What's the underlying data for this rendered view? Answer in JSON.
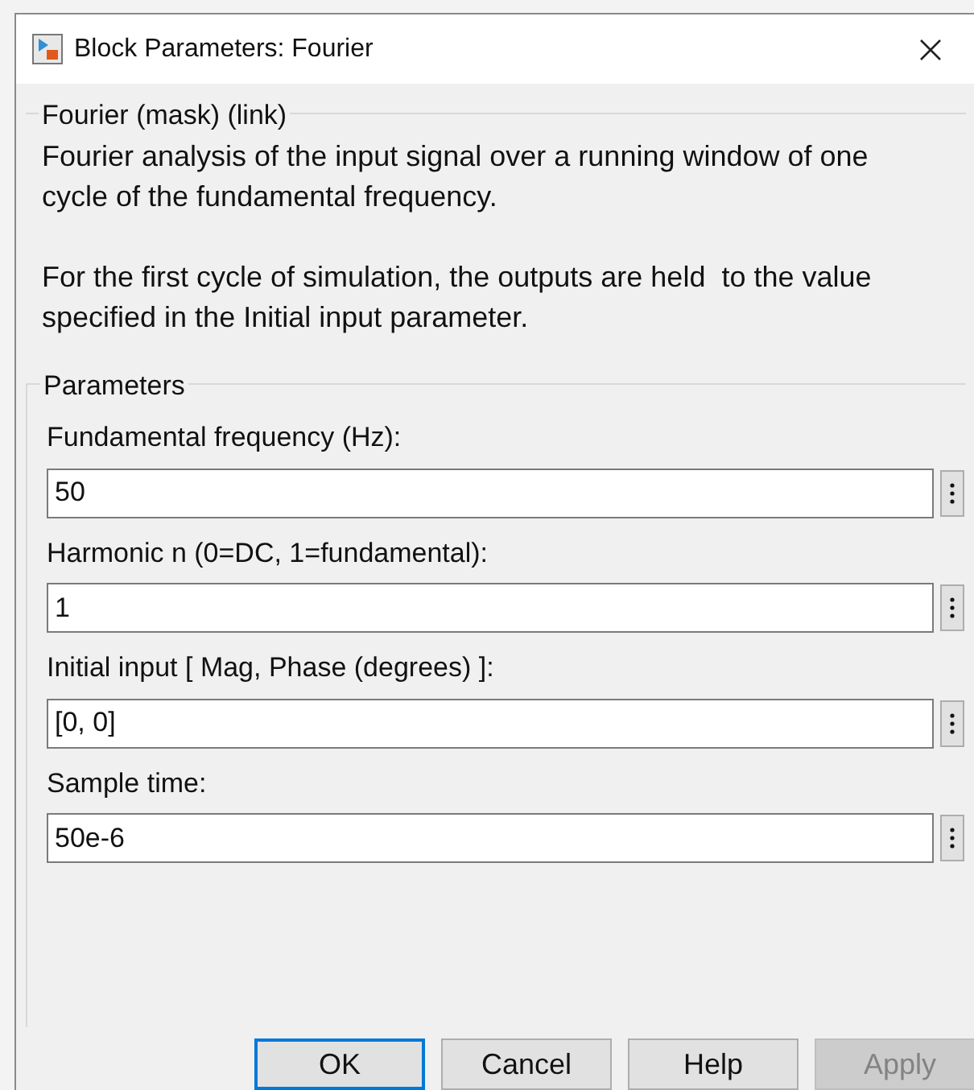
{
  "window": {
    "title": "Block Parameters: Fourier"
  },
  "description_group": {
    "title": "Fourier (mask) (link)",
    "paragraphs": [
      "Fourier analysis of the input signal over a running window of one cycle of the fundamental frequency.",
      "For the first cycle of simulation, the outputs are held  to the value specified in the Initial input parameter."
    ]
  },
  "parameters_group": {
    "title": "Parameters",
    "fields": [
      {
        "label": "Fundamental frequency (Hz):",
        "value": "50"
      },
      {
        "label": "Harmonic n (0=DC, 1=fundamental):",
        "value": "1"
      },
      {
        "label": "Initial input [ Mag, Phase (degrees) ]:",
        "value": "[0, 0]"
      },
      {
        "label": "Sample time:",
        "value": "50e-6"
      }
    ]
  },
  "buttons": [
    {
      "label": "OK",
      "focused": true,
      "disabled": false
    },
    {
      "label": "Cancel",
      "focused": false,
      "disabled": false
    },
    {
      "label": "Help",
      "focused": false,
      "disabled": false
    },
    {
      "label": "Apply",
      "focused": false,
      "disabled": true
    }
  ]
}
